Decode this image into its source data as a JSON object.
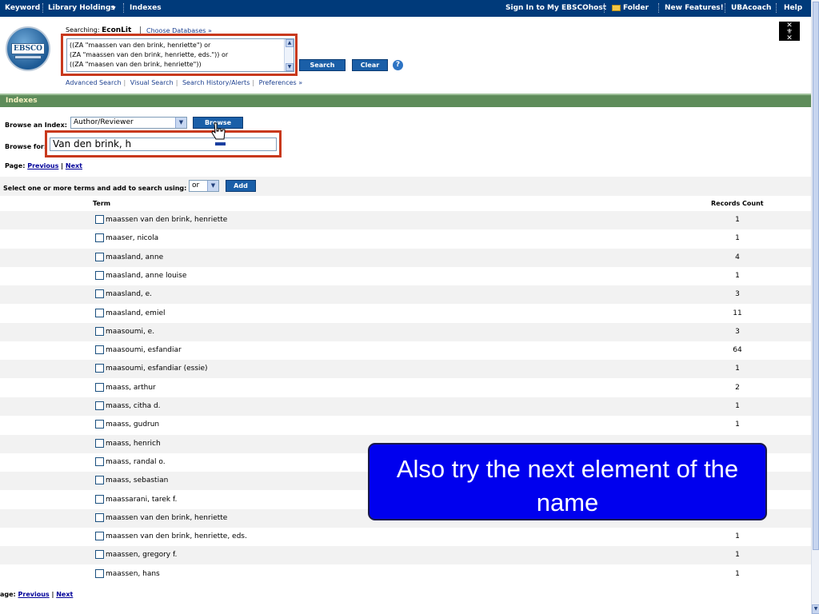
{
  "topnav": {
    "keyword": "Keyword",
    "library_holdings": "Library Holdings",
    "library_holdings_arrow": "▼",
    "indexes": "Indexes",
    "sign_in": "Sign In to My EBSCOhost",
    "folder": "Folder",
    "new_features": "New Features!",
    "ubacoach": "UBAcoach",
    "help": "Help",
    "colors": {
      "background": "#003a7a",
      "text": "#ffffff"
    }
  },
  "logo": {
    "text": "EBSCO"
  },
  "search": {
    "searching_label": "Searching:",
    "database": "EconLit",
    "choose_databases": "Choose Databases »",
    "query_lines": [
      "((ZA \"maassen van den brink, henriette\") or",
      "(ZA \"maassen van den brink, henriette, eds.\"))  or",
      "((ZA \"maasen van den brink, henriette\"))"
    ],
    "search_button": "Search",
    "clear_button": "Clear",
    "help_icon": "?",
    "highlight_color": "#c8391d"
  },
  "sublinks": {
    "advanced": "Advanced Search",
    "visual": "Visual Search",
    "history": "Search History/Alerts",
    "preferences": "Preferences »"
  },
  "indexes_bar": {
    "title": "Indexes",
    "color": "#5e8c5a"
  },
  "browse": {
    "index_label": "Browse an Index:",
    "index_value": "Author/Reviewer",
    "browse_button": "Browse",
    "for_label": "Browse for:",
    "for_value": "Van den brink, h"
  },
  "paging": {
    "label": "Page:",
    "previous": "Previous",
    "separator": "|",
    "next": "Next",
    "bottom_label": "age:"
  },
  "add_terms": {
    "label": "Select one or more terms and add to search using:",
    "operator": "or",
    "add_button": "Add"
  },
  "table": {
    "headers": {
      "term": "Term",
      "count": "Records Count"
    },
    "rows": [
      {
        "term": "maassen van den brink, henriette",
        "count": "1"
      },
      {
        "term": "maaser, nicola",
        "count": "1"
      },
      {
        "term": "maasland, anne",
        "count": "4"
      },
      {
        "term": "maasland, anne louise",
        "count": "1"
      },
      {
        "term": "maasland, e.",
        "count": "3"
      },
      {
        "term": "maasland, emiel",
        "count": "11"
      },
      {
        "term": "maasoumi, e.",
        "count": "3"
      },
      {
        "term": "maasoumi, esfandiar",
        "count": "64"
      },
      {
        "term": "maasoumi, esfandiar (essie)",
        "count": "1"
      },
      {
        "term": "maass, arthur",
        "count": "2"
      },
      {
        "term": "maass, citha d.",
        "count": "1"
      },
      {
        "term": "maass, gudrun",
        "count": "1"
      },
      {
        "term": "maass, henrich",
        "count": ""
      },
      {
        "term": "maass, randal o.",
        "count": ""
      },
      {
        "term": "maass, sebastian",
        "count": ""
      },
      {
        "term": "maassarani, tarek f.",
        "count": ""
      },
      {
        "term": "maassen van den brink, henriette",
        "count": ""
      },
      {
        "term": "maassen van den brink, henriette, eds.",
        "count": "1"
      },
      {
        "term": "maassen, gregory f.",
        "count": "1"
      },
      {
        "term": "maassen, hans",
        "count": "1"
      }
    ]
  },
  "callout": {
    "text": "Also try the next element of the name",
    "color": "#0000ee"
  }
}
